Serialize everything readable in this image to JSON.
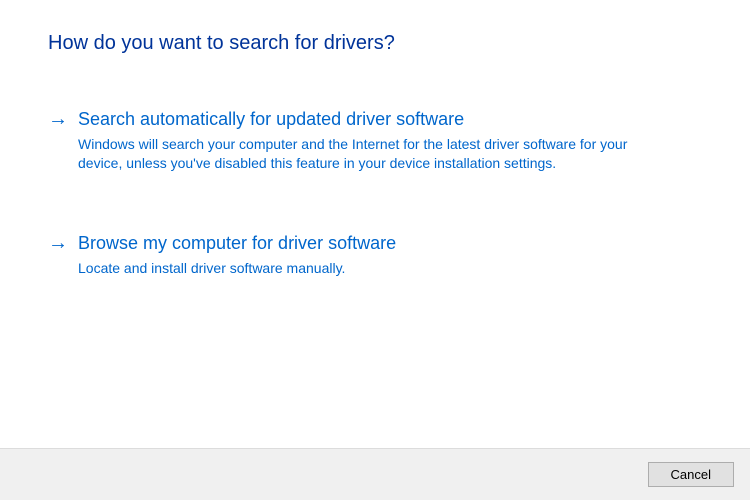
{
  "heading": "How do you want to search for drivers?",
  "options": [
    {
      "title": "Search automatically for updated driver software",
      "description": "Windows will search your computer and the Internet for the latest driver software for your device, unless you've disabled this feature in your device installation settings."
    },
    {
      "title": "Browse my computer for driver software",
      "description": "Locate and install driver software manually."
    }
  ],
  "footer": {
    "cancel_label": "Cancel"
  }
}
